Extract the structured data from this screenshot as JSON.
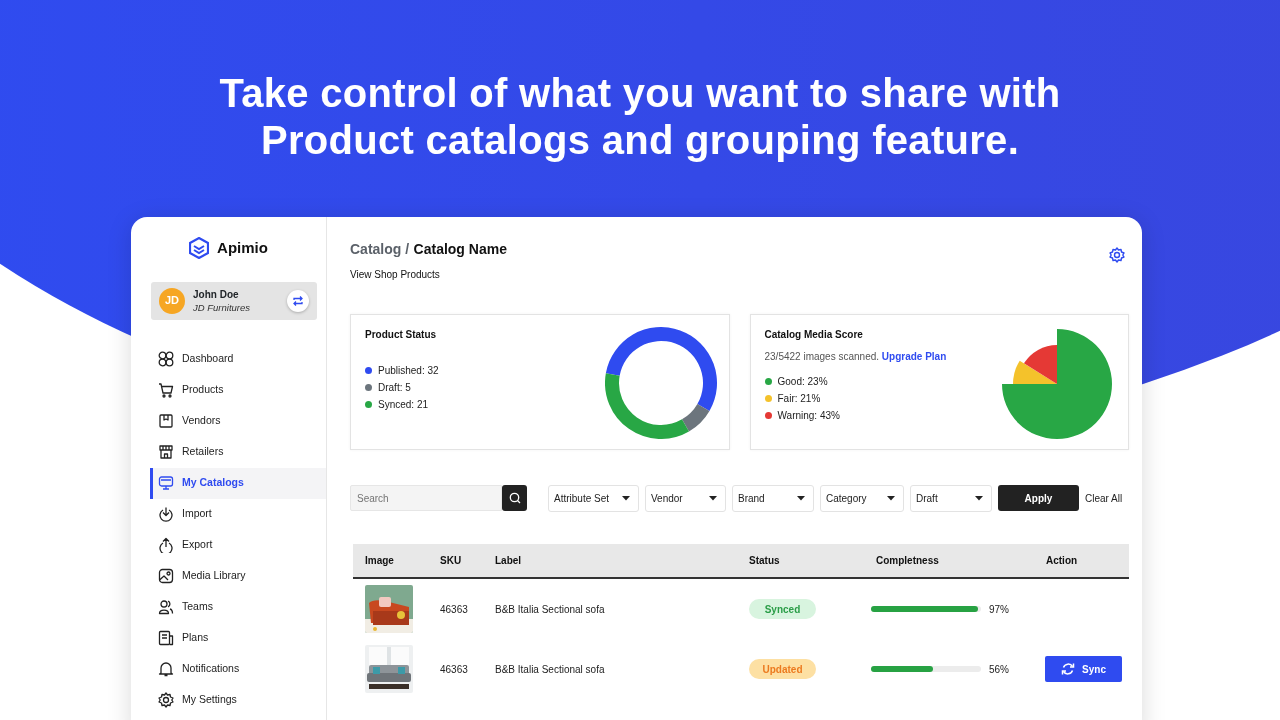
{
  "headline": "Take control of what you want to share with Product catalogs and grouping feature.",
  "sidebar": {
    "logo": "Apimio",
    "user": {
      "initials": "JD",
      "name": "John Doe",
      "company": "JD Furnitures"
    },
    "items": [
      {
        "label": "Dashboard",
        "selected": false
      },
      {
        "label": "Products",
        "selected": false
      },
      {
        "label": "Vendors",
        "selected": false
      },
      {
        "label": "Retailers",
        "selected": false
      },
      {
        "label": "My Catalogs",
        "selected": true
      },
      {
        "label": "Import",
        "selected": false
      },
      {
        "label": "Export",
        "selected": false
      },
      {
        "label": "Media Library",
        "selected": false
      },
      {
        "label": "Teams",
        "selected": false
      },
      {
        "label": "Plans",
        "selected": false
      },
      {
        "label": "Notifications",
        "selected": false
      },
      {
        "label": "My Settings",
        "selected": false
      }
    ]
  },
  "header": {
    "breadcrumb_parent": "Catalog /",
    "breadcrumb_current": "Catalog Name",
    "subtitle": "View Shop Products"
  },
  "product_status": {
    "title": "Product Status",
    "legend": [
      {
        "text": "Published: 32",
        "color": "#2f4bf0"
      },
      {
        "text": "Draft: 5",
        "color": "#6c757d"
      },
      {
        "text": "Synced: 21",
        "color": "#28a745"
      }
    ]
  },
  "media_score": {
    "title": "Catalog Media Score",
    "scanned": "23/5422 images scanned.",
    "link": "Upgrade Plan",
    "legend": [
      {
        "text": "Good: 23%",
        "color": "#28a745"
      },
      {
        "text": "Fair: 21%",
        "color": "#f4c22b"
      },
      {
        "text": "Warning: 43%",
        "color": "#e53935"
      }
    ]
  },
  "filters": {
    "search_placeholder": "Search",
    "dropdowns": [
      {
        "label": "Attribute Set"
      },
      {
        "label": "Vendor"
      },
      {
        "label": "Brand"
      },
      {
        "label": "Category"
      },
      {
        "label": "Draft"
      }
    ],
    "apply": "Apply",
    "clear": "Clear All"
  },
  "table": {
    "columns": [
      "Image",
      "SKU",
      "Label",
      "Status",
      "Completness",
      "Action"
    ],
    "rows": [
      {
        "sku": "46363",
        "label": "B&B Italia Sectional sofa",
        "status": {
          "text": "Synced",
          "kind": "synced"
        },
        "level": 0.97,
        "reading": "97%"
      },
      {
        "sku": "46363",
        "label": "B&B Italia Sectional sofa",
        "status": {
          "text": "Updated",
          "kind": "updated"
        },
        "level": 0.56,
        "reading": "56%",
        "action": "Sync"
      }
    ]
  }
}
